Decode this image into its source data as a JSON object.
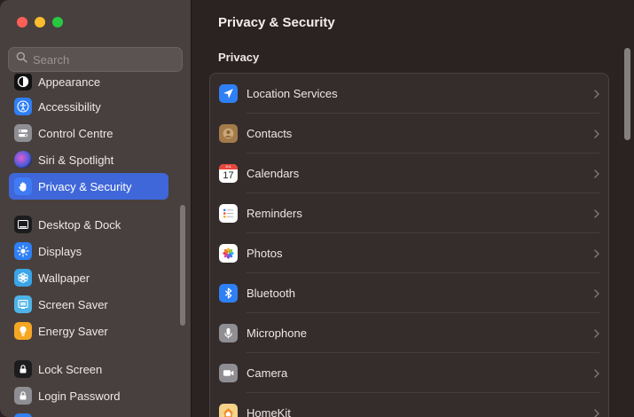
{
  "window": {
    "traffic_lights": [
      "close",
      "minimize",
      "zoom"
    ]
  },
  "sidebar": {
    "search_placeholder": "Search",
    "items": [
      {
        "label": "Appearance",
        "icon": "appearance-icon",
        "color": "#1a1a1a",
        "selected": false
      },
      {
        "label": "Accessibility",
        "icon": "accessibility-icon",
        "color": "#2f7ff5",
        "selected": false
      },
      {
        "label": "Control Centre",
        "icon": "control-centre-icon",
        "color": "#8e8e93",
        "selected": false
      },
      {
        "label": "Siri & Spotlight",
        "icon": "siri-icon",
        "color": "#222",
        "selected": false
      },
      {
        "label": "Privacy & Security",
        "icon": "hand-icon",
        "color": "#3f7bf5",
        "selected": true
      },
      {
        "label": "Desktop & Dock",
        "icon": "dock-icon",
        "color": "#1c1c1e",
        "selected": false
      },
      {
        "label": "Displays",
        "icon": "displays-icon",
        "color": "#2f7ff5",
        "selected": false
      },
      {
        "label": "Wallpaper",
        "icon": "wallpaper-icon",
        "color": "#3aa5e8",
        "selected": false
      },
      {
        "label": "Screen Saver",
        "icon": "screen-saver-icon",
        "color": "#4fb3e6",
        "selected": false
      },
      {
        "label": "Energy Saver",
        "icon": "energy-saver-icon",
        "color": "#f5a623",
        "selected": false
      },
      {
        "label": "Lock Screen",
        "icon": "lock-screen-icon",
        "color": "#1c1c1e",
        "selected": false
      },
      {
        "label": "Login Password",
        "icon": "login-password-icon",
        "color": "#8e8e93",
        "selected": false
      }
    ]
  },
  "main": {
    "title": "Privacy & Security",
    "section": "Privacy",
    "rows": [
      {
        "label": "Location Services",
        "icon": "location-icon",
        "color": "#2f7ff5"
      },
      {
        "label": "Contacts",
        "icon": "contacts-icon",
        "color": "#a37a4a"
      },
      {
        "label": "Calendars",
        "icon": "calendar-icon",
        "color": "#ffffff",
        "calendar_month": "JUL",
        "calendar_day": "17"
      },
      {
        "label": "Reminders",
        "icon": "reminders-icon",
        "color": "#ffffff"
      },
      {
        "label": "Photos",
        "icon": "photos-icon",
        "color": "#ffffff"
      },
      {
        "label": "Bluetooth",
        "icon": "bluetooth-icon",
        "color": "#2f7ff5"
      },
      {
        "label": "Microphone",
        "icon": "microphone-icon",
        "color": "#8e8e93"
      },
      {
        "label": "Camera",
        "icon": "camera-icon",
        "color": "#8e8e93"
      },
      {
        "label": "HomeKit",
        "icon": "homekit-icon",
        "color": "#f5d38a"
      }
    ]
  }
}
